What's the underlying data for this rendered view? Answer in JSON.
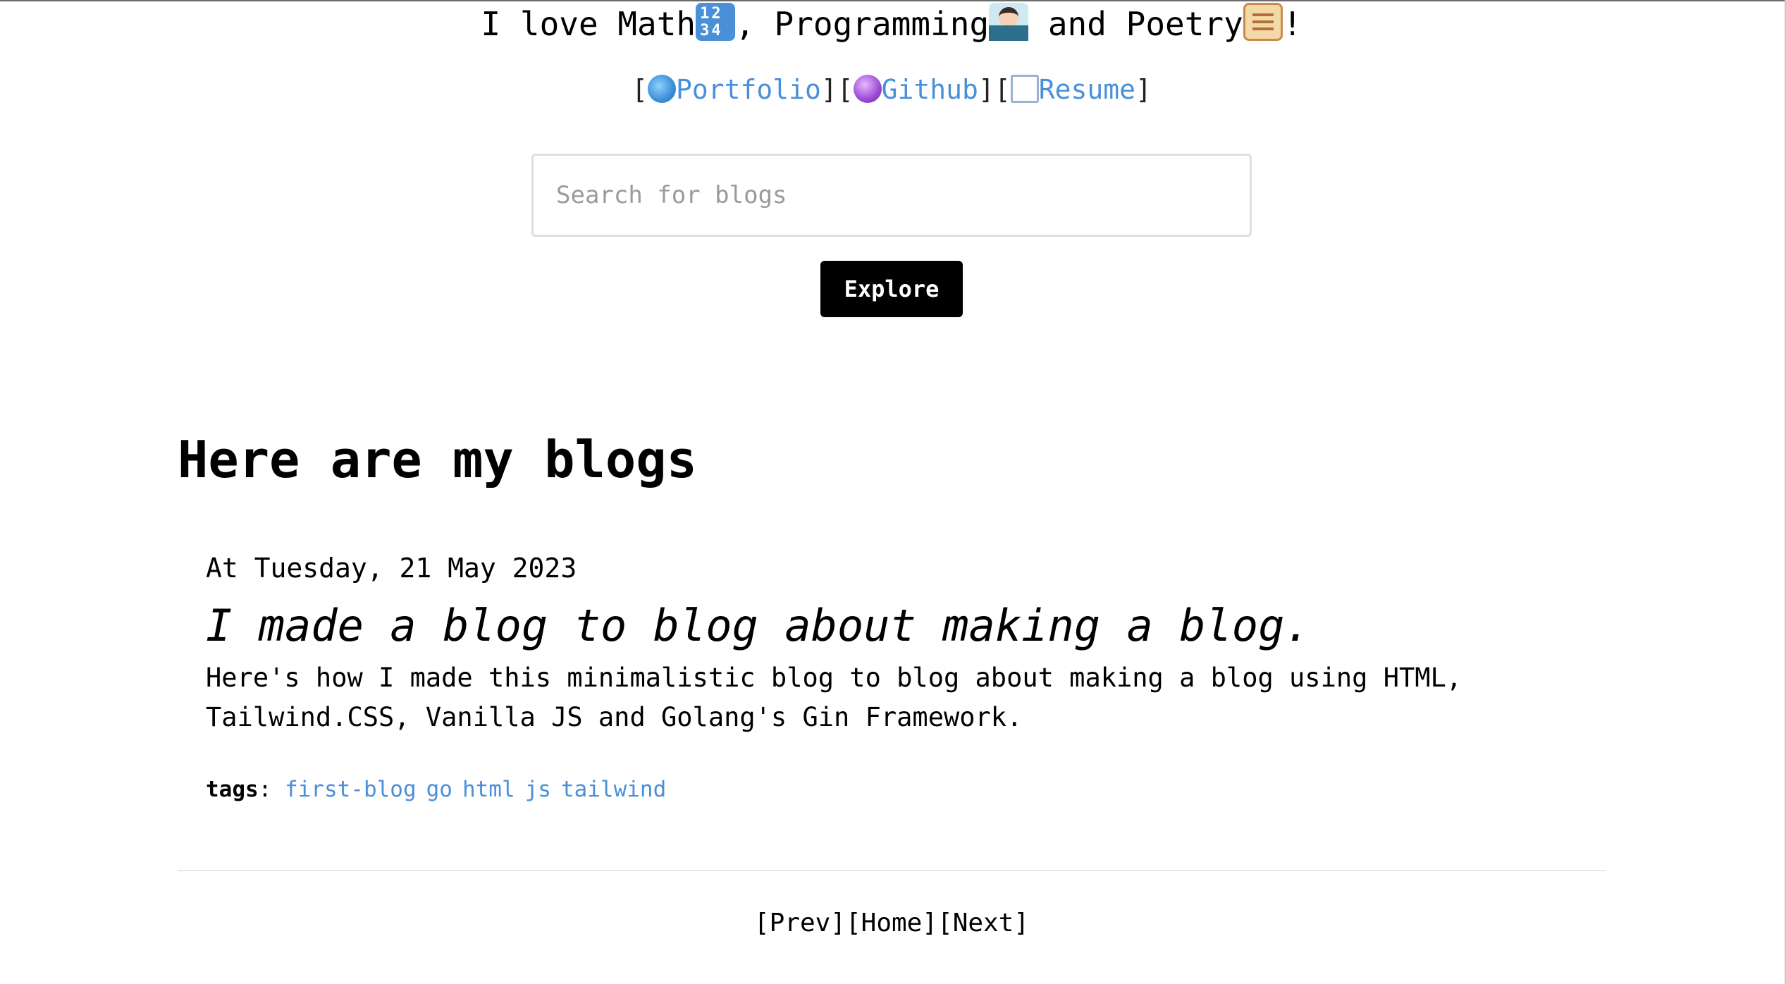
{
  "header": {
    "tagline_parts": [
      "I love Math",
      ", Programming",
      " and Poetry",
      "!"
    ],
    "emoji_icons": [
      "input-numbers-icon",
      "technologist-icon",
      "scroll-icon"
    ]
  },
  "links": {
    "bracket_open": "[",
    "bracket_close": "]",
    "items": [
      {
        "label": "Portfolio",
        "icon": "globe-icon"
      },
      {
        "label": "Github",
        "icon": "crystal-ball-icon"
      },
      {
        "label": "Resume",
        "icon": "page-icon"
      }
    ]
  },
  "search": {
    "placeholder": "Search for blogs",
    "value": ""
  },
  "explore_button": {
    "label": "Explore"
  },
  "blogs": {
    "heading": "Here are my blogs",
    "posts": [
      {
        "date_text": "At Tuesday, 21 May 2023",
        "title": "I made a blog to blog about making a blog.",
        "summary": "Here's how I made this minimalistic blog to blog about making a blog using HTML, Tailwind.CSS, Vanilla JS and Golang's Gin Framework.",
        "tags_label": "tags",
        "tags": [
          "first-blog",
          "go",
          "html",
          "js",
          "tailwind"
        ]
      }
    ]
  },
  "pagination": {
    "prev": "[Prev]",
    "home": "[Home]",
    "next": "[Next]"
  },
  "colors": {
    "link": "#4a90d9",
    "text": "#000000",
    "button_bg": "#000000",
    "button_text": "#ffffff",
    "placeholder": "#9a9a9a"
  }
}
